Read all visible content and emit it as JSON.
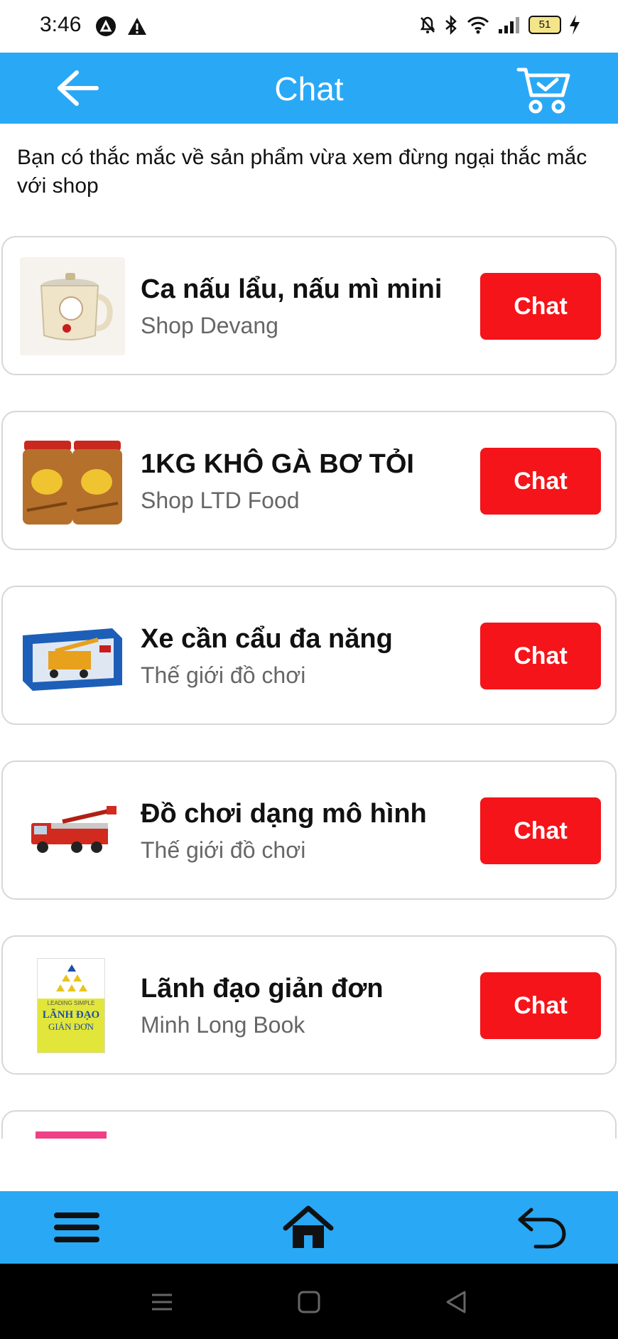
{
  "status_bar": {
    "time": "3:46",
    "battery": "51"
  },
  "app_bar": {
    "title": "Chat",
    "back_icon": "arrow-left-icon",
    "cart_icon": "shopping-cart-icon"
  },
  "intro_text": "Bạn có thắc mắc về sản phẩm vừa xem đừng ngại thắc mắc với shop",
  "products": [
    {
      "name": "Ca nấu lẩu, nấu mì mini",
      "shop": "Shop Devang",
      "chat_label": "Chat",
      "thumb": "kettle"
    },
    {
      "name": "1KG KHÔ GÀ BƠ TỎI",
      "shop": "Shop LTD Food",
      "chat_label": "Chat",
      "thumb": "jars"
    },
    {
      "name": "Xe cần cẩu đa năng",
      "shop": "Thế giới đồ chơi",
      "chat_label": "Chat",
      "thumb": "crane-box"
    },
    {
      "name": "Đồ chơi dạng mô hình",
      "shop": "Thế giới đồ chơi",
      "chat_label": "Chat",
      "thumb": "fire-truck"
    },
    {
      "name": "Lãnh đạo giản đơn",
      "shop": "Minh Long Book",
      "chat_label": "Chat",
      "thumb": "book"
    }
  ],
  "book_cover_text": {
    "top": "LEADING SIMPLE",
    "line1": "LÃNH ĐẠO",
    "line2": "GIẢN ĐƠN"
  },
  "bottom_nav": {
    "menu_icon": "hamburger-menu-icon",
    "home_icon": "home-icon",
    "back_icon": "undo-arrow-icon"
  },
  "colors": {
    "primary": "#29a8f6",
    "chat_button": "#f4141a",
    "muted_text": "#666666"
  }
}
